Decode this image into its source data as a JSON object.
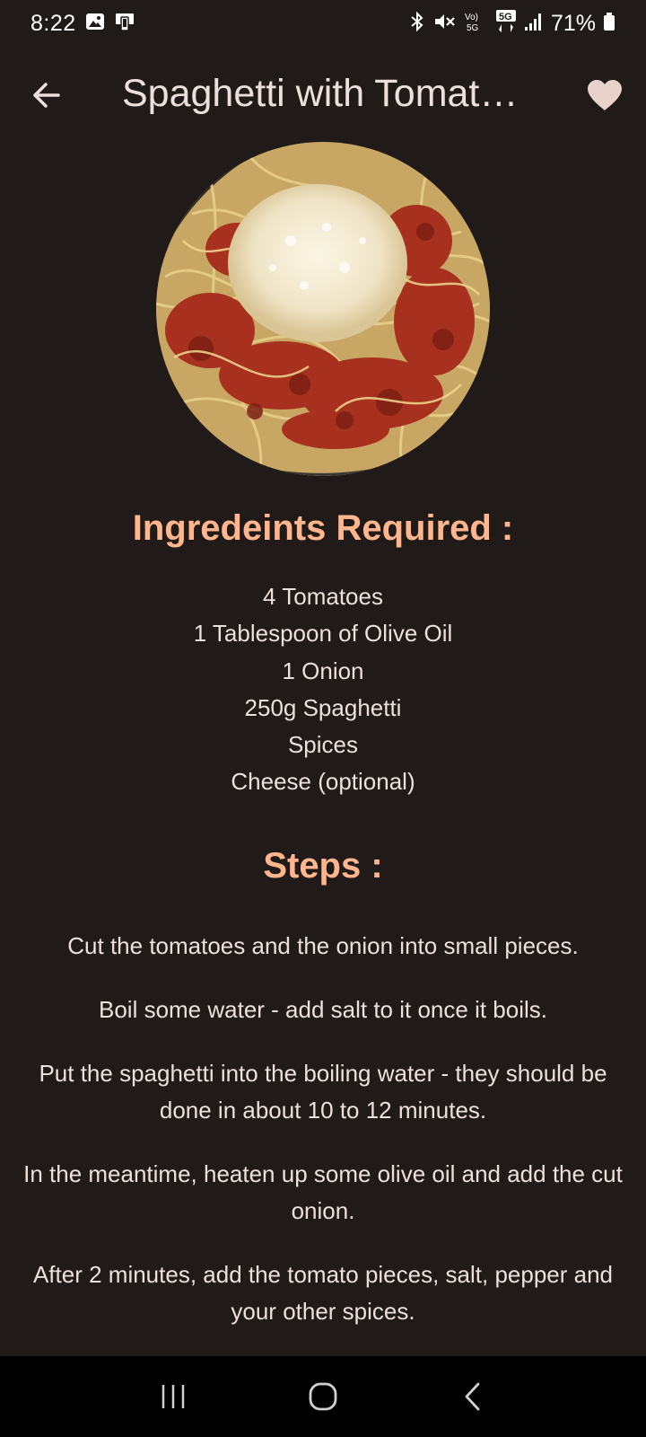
{
  "status_bar": {
    "time": "8:22",
    "battery": "71%",
    "left_icons": [
      "gallery-icon",
      "device-icon"
    ],
    "right_icons": [
      "bluetooth-icon",
      "mute-icon",
      "volte-icon",
      "5g-icon",
      "signal-icon",
      "battery-icon"
    ],
    "volte_label": "Vo) 5G",
    "network_label": "5G"
  },
  "app_bar": {
    "title": "Spaghetti with Tomat…",
    "back_icon": "arrow-back-icon",
    "favorite_icon": "heart-icon"
  },
  "recipe": {
    "ingredients_heading": "Ingredeints Required :",
    "ingredients": [
      "4 Tomatoes",
      "1 Tablespoon of Olive Oil",
      "1 Onion",
      "250g Spaghetti",
      "Spices",
      "Cheese (optional)"
    ],
    "steps_heading": "Steps :",
    "steps": [
      "Cut the tomatoes and the onion into small pieces.",
      "Boil some water - add salt to it once it boils.",
      "Put the spaghetti into the boiling water - they should be done in about 10 to 12 minutes.",
      "In the meantime, heaten up some olive oil and add the cut onion.",
      "After 2 minutes, add the tomato pieces, salt, pepper and your other spices."
    ]
  },
  "nav_bar": {
    "icons": [
      "recents-icon",
      "home-icon",
      "back-icon"
    ]
  },
  "colors": {
    "background": "#201a18",
    "accent": "#ffb68f",
    "text": "#ece0dc",
    "heart": "#e8d2cb"
  }
}
